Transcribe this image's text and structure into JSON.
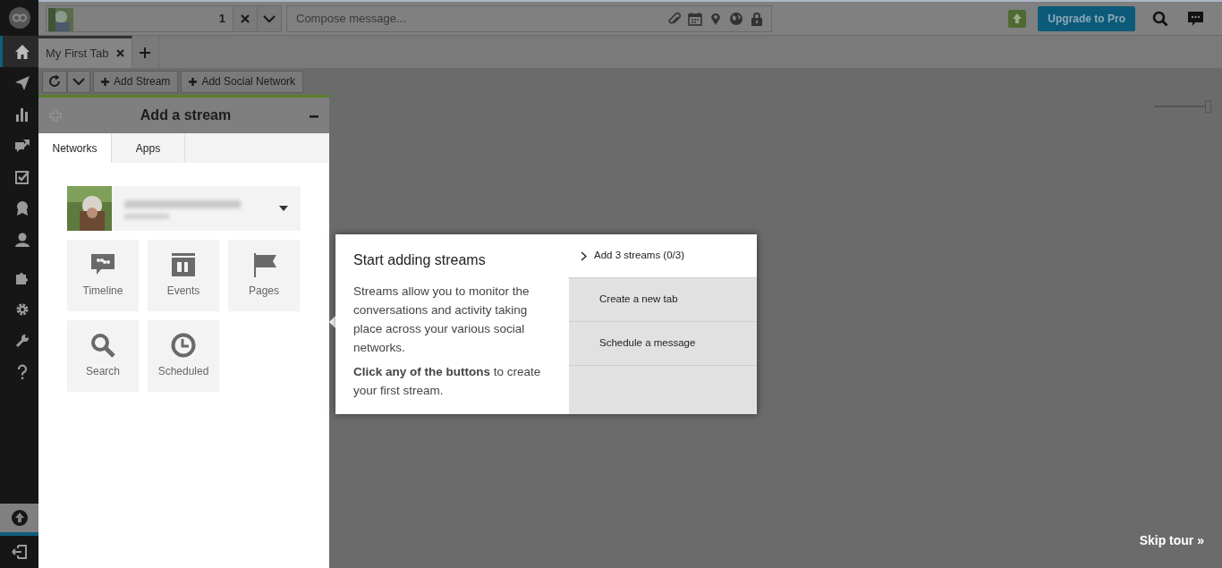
{
  "sidebar": {
    "items": [
      {
        "kind": "home",
        "selected": true
      },
      {
        "kind": "send",
        "selected": false
      },
      {
        "kind": "analytics",
        "selected": false
      },
      {
        "kind": "assign",
        "selected": false
      },
      {
        "kind": "tasks",
        "selected": false
      },
      {
        "kind": "award",
        "selected": false
      },
      {
        "kind": "contacts",
        "selected": false
      },
      {
        "kind": "apps",
        "selected": false
      },
      {
        "kind": "settings",
        "selected": false
      },
      {
        "kind": "tools",
        "selected": false
      },
      {
        "kind": "help",
        "selected": false
      }
    ],
    "bottom_items": [
      {
        "kind": "upgrade",
        "selected": true
      },
      {
        "kind": "logout",
        "selected": false
      }
    ]
  },
  "top_bar": {
    "profile_count": "1",
    "compose": {
      "placeholder": "Compose message..."
    },
    "upgrade_button": "Upgrade to Pro"
  },
  "tabs": [
    {
      "label": "My First Tab",
      "selected": true
    }
  ],
  "toolbar": {
    "buttons": [
      "Add Stream",
      "Add Social Network"
    ]
  },
  "zoom_slider": {
    "level": 1
  },
  "panel": {
    "title": "Add a stream",
    "tabs": [
      {
        "label": "Networks",
        "selected": true
      },
      {
        "label": "Apps",
        "selected": false
      }
    ],
    "stream_types": [
      {
        "kind": "timeline",
        "label": "Timeline"
      },
      {
        "kind": "events",
        "label": "Events"
      },
      {
        "kind": "pages",
        "label": "Pages"
      },
      {
        "kind": "search",
        "label": "Search"
      },
      {
        "kind": "scheduled",
        "label": "Scheduled"
      }
    ]
  },
  "tour": {
    "title": "Start adding streams",
    "paragraphs": [
      "Streams allow you to monitor the conversations and activity taking place across your various social networks.",
      "**Click any of the buttons** to create your first stream."
    ],
    "steps": [
      {
        "label": "Add 3 streams (0/3)",
        "selected": true
      },
      {
        "label": "Create a new tab",
        "selected": false
      },
      {
        "label": "Schedule a message",
        "selected": false
      }
    ],
    "skip": "Skip tour »"
  }
}
